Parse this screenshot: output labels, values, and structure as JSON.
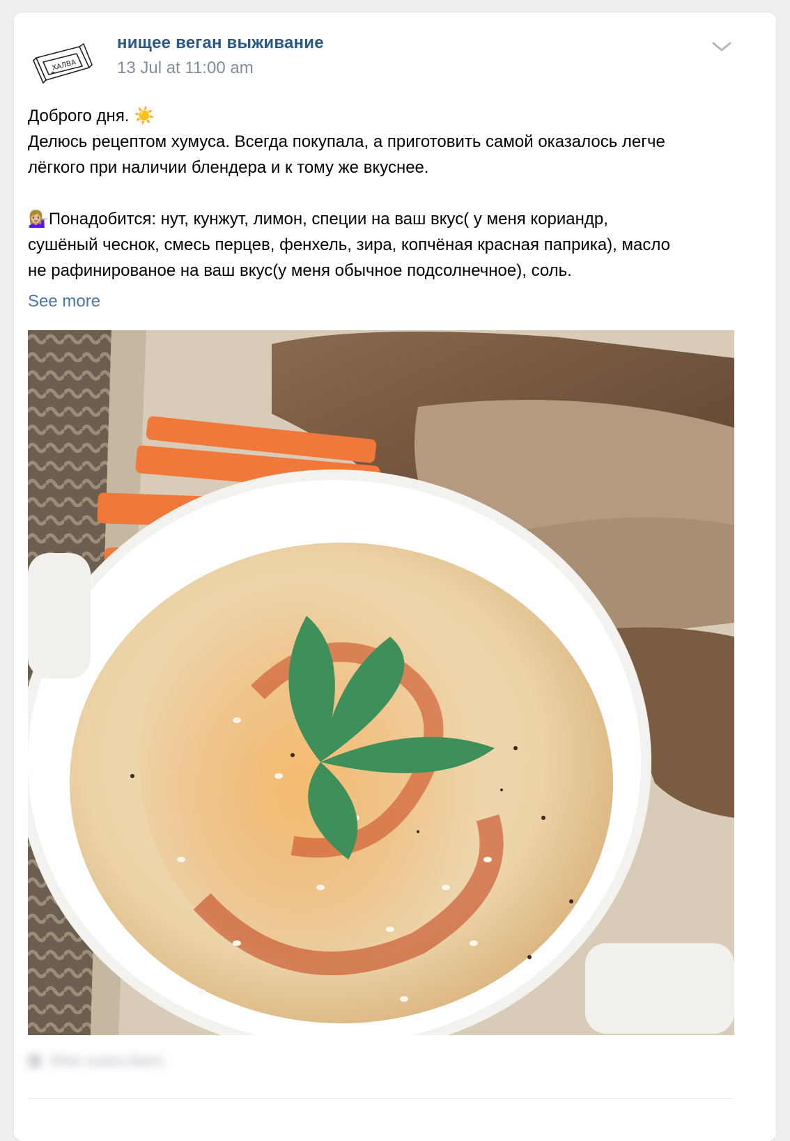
{
  "post": {
    "author": "нищее веган выживание",
    "date": "13 Jul at 11:00 am",
    "avatar_icon": "halva-wrapper-logo",
    "avatar_logo_text": "ХАЛВА",
    "menu_icon": "chevron-down-icon",
    "text": {
      "line1": "Доброго дня. ",
      "line1_emoji": "☀️",
      "line2": "Делюсь рецептом хумуса. Всегда покупала, а приготовить самой оказалось легче",
      "line3": "лёгкого при наличии блендера и к тому же вкуснее.",
      "line4_emoji": "💁🏼‍♀️",
      "line4": "Понадобится: нут, кунжут, лимон, специи на ваш вкус( у меня кориандр,",
      "line5": "сушёный чеснок, смесь перцев, фенхель, зира, копчёная красная паприка), масло",
      "line6": "не рафинированое на ваш вкус(у меня обычное подсолнечное), соль."
    },
    "see_more": "See more",
    "photo_icon": "hummus-photo",
    "footer_blurred": "Web subscribers"
  },
  "colors": {
    "link": "#2a5885",
    "meta": "#818c99",
    "background": "#edeef0"
  }
}
